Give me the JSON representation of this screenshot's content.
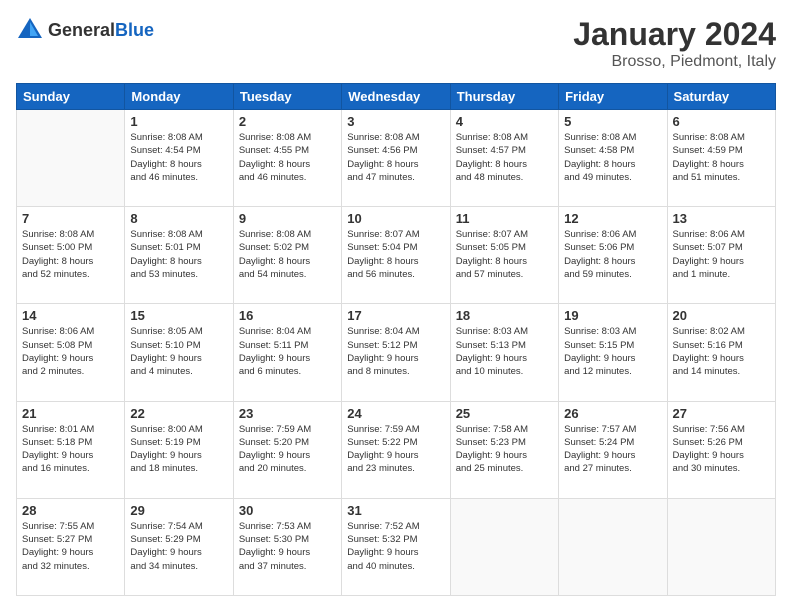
{
  "logo": {
    "general": "General",
    "blue": "Blue"
  },
  "header": {
    "title": "January 2024",
    "subtitle": "Brosso, Piedmont, Italy"
  },
  "days_of_week": [
    "Sunday",
    "Monday",
    "Tuesday",
    "Wednesday",
    "Thursday",
    "Friday",
    "Saturday"
  ],
  "weeks": [
    [
      {
        "day": "",
        "info": ""
      },
      {
        "day": "1",
        "info": "Sunrise: 8:08 AM\nSunset: 4:54 PM\nDaylight: 8 hours\nand 46 minutes."
      },
      {
        "day": "2",
        "info": "Sunrise: 8:08 AM\nSunset: 4:55 PM\nDaylight: 8 hours\nand 46 minutes."
      },
      {
        "day": "3",
        "info": "Sunrise: 8:08 AM\nSunset: 4:56 PM\nDaylight: 8 hours\nand 47 minutes."
      },
      {
        "day": "4",
        "info": "Sunrise: 8:08 AM\nSunset: 4:57 PM\nDaylight: 8 hours\nand 48 minutes."
      },
      {
        "day": "5",
        "info": "Sunrise: 8:08 AM\nSunset: 4:58 PM\nDaylight: 8 hours\nand 49 minutes."
      },
      {
        "day": "6",
        "info": "Sunrise: 8:08 AM\nSunset: 4:59 PM\nDaylight: 8 hours\nand 51 minutes."
      }
    ],
    [
      {
        "day": "7",
        "info": "Sunrise: 8:08 AM\nSunset: 5:00 PM\nDaylight: 8 hours\nand 52 minutes."
      },
      {
        "day": "8",
        "info": "Sunrise: 8:08 AM\nSunset: 5:01 PM\nDaylight: 8 hours\nand 53 minutes."
      },
      {
        "day": "9",
        "info": "Sunrise: 8:08 AM\nSunset: 5:02 PM\nDaylight: 8 hours\nand 54 minutes."
      },
      {
        "day": "10",
        "info": "Sunrise: 8:07 AM\nSunset: 5:04 PM\nDaylight: 8 hours\nand 56 minutes."
      },
      {
        "day": "11",
        "info": "Sunrise: 8:07 AM\nSunset: 5:05 PM\nDaylight: 8 hours\nand 57 minutes."
      },
      {
        "day": "12",
        "info": "Sunrise: 8:06 AM\nSunset: 5:06 PM\nDaylight: 8 hours\nand 59 minutes."
      },
      {
        "day": "13",
        "info": "Sunrise: 8:06 AM\nSunset: 5:07 PM\nDaylight: 9 hours\nand 1 minute."
      }
    ],
    [
      {
        "day": "14",
        "info": "Sunrise: 8:06 AM\nSunset: 5:08 PM\nDaylight: 9 hours\nand 2 minutes."
      },
      {
        "day": "15",
        "info": "Sunrise: 8:05 AM\nSunset: 5:10 PM\nDaylight: 9 hours\nand 4 minutes."
      },
      {
        "day": "16",
        "info": "Sunrise: 8:04 AM\nSunset: 5:11 PM\nDaylight: 9 hours\nand 6 minutes."
      },
      {
        "day": "17",
        "info": "Sunrise: 8:04 AM\nSunset: 5:12 PM\nDaylight: 9 hours\nand 8 minutes."
      },
      {
        "day": "18",
        "info": "Sunrise: 8:03 AM\nSunset: 5:13 PM\nDaylight: 9 hours\nand 10 minutes."
      },
      {
        "day": "19",
        "info": "Sunrise: 8:03 AM\nSunset: 5:15 PM\nDaylight: 9 hours\nand 12 minutes."
      },
      {
        "day": "20",
        "info": "Sunrise: 8:02 AM\nSunset: 5:16 PM\nDaylight: 9 hours\nand 14 minutes."
      }
    ],
    [
      {
        "day": "21",
        "info": "Sunrise: 8:01 AM\nSunset: 5:18 PM\nDaylight: 9 hours\nand 16 minutes."
      },
      {
        "day": "22",
        "info": "Sunrise: 8:00 AM\nSunset: 5:19 PM\nDaylight: 9 hours\nand 18 minutes."
      },
      {
        "day": "23",
        "info": "Sunrise: 7:59 AM\nSunset: 5:20 PM\nDaylight: 9 hours\nand 20 minutes."
      },
      {
        "day": "24",
        "info": "Sunrise: 7:59 AM\nSunset: 5:22 PM\nDaylight: 9 hours\nand 23 minutes."
      },
      {
        "day": "25",
        "info": "Sunrise: 7:58 AM\nSunset: 5:23 PM\nDaylight: 9 hours\nand 25 minutes."
      },
      {
        "day": "26",
        "info": "Sunrise: 7:57 AM\nSunset: 5:24 PM\nDaylight: 9 hours\nand 27 minutes."
      },
      {
        "day": "27",
        "info": "Sunrise: 7:56 AM\nSunset: 5:26 PM\nDaylight: 9 hours\nand 30 minutes."
      }
    ],
    [
      {
        "day": "28",
        "info": "Sunrise: 7:55 AM\nSunset: 5:27 PM\nDaylight: 9 hours\nand 32 minutes."
      },
      {
        "day": "29",
        "info": "Sunrise: 7:54 AM\nSunset: 5:29 PM\nDaylight: 9 hours\nand 34 minutes."
      },
      {
        "day": "30",
        "info": "Sunrise: 7:53 AM\nSunset: 5:30 PM\nDaylight: 9 hours\nand 37 minutes."
      },
      {
        "day": "31",
        "info": "Sunrise: 7:52 AM\nSunset: 5:32 PM\nDaylight: 9 hours\nand 40 minutes."
      },
      {
        "day": "",
        "info": ""
      },
      {
        "day": "",
        "info": ""
      },
      {
        "day": "",
        "info": ""
      }
    ]
  ]
}
